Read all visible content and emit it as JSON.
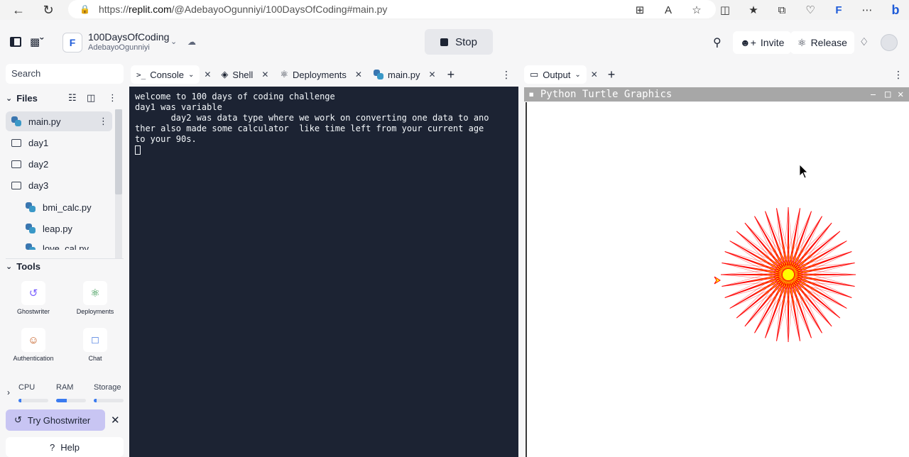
{
  "browser": {
    "url_prefix": "https://",
    "url_domain": "replit.com",
    "url_path": "/@AdebayoOgunniyi/100DaysOfCoding#main.py"
  },
  "header": {
    "repl_name": "100DaysOfCoding",
    "owner": "AdebayoOgunniyi",
    "stop_label": "Stop",
    "invite_label": "Invite",
    "release_label": "Release"
  },
  "sidebar": {
    "search_placeholder": "Search",
    "files_label": "Files",
    "files": [
      {
        "name": "main.py",
        "type": "python"
      },
      {
        "name": "day1",
        "type": "folder"
      },
      {
        "name": "day2",
        "type": "folder"
      },
      {
        "name": "day3",
        "type": "folder"
      },
      {
        "name": "bmi_calc.py",
        "type": "python"
      },
      {
        "name": "leap.py",
        "type": "python"
      },
      {
        "name": "love_cal.py",
        "type": "python"
      }
    ],
    "tools_label": "Tools",
    "tools": [
      {
        "label": "Ghostwriter",
        "icon": "ghostwriter-icon"
      },
      {
        "label": "Deployments",
        "icon": "deployments-icon"
      },
      {
        "label": "Authentication",
        "icon": "authentication-icon"
      },
      {
        "label": "Chat",
        "icon": "chat-icon"
      }
    ],
    "resources": {
      "cpu_label": "CPU",
      "ram_label": "RAM",
      "storage_label": "Storage",
      "cpu": 0.1,
      "ram": 0.35,
      "storage": 0.1
    },
    "try_ghostwriter": "Try Ghostwriter",
    "help": "Help"
  },
  "left_tabs": [
    {
      "label": "Console",
      "icon": "terminal-icon"
    },
    {
      "label": "Shell",
      "icon": "shell-icon"
    },
    {
      "label": "Deployments",
      "icon": "deployments-icon"
    },
    {
      "label": "main.py",
      "icon": "python-icon"
    }
  ],
  "console": {
    "lines": [
      "welcome to 100 days of coding challenge",
      "day1 was variable",
      "       day2 was data type where we work on converting one data to ano",
      "ther also made some calculator  like time left from your current age",
      "to your 90s."
    ]
  },
  "output": {
    "tab_label": "Output",
    "window_title": "Python Turtle Graphics",
    "star_colors": {
      "stroke": "#ff0000",
      "fill": "#ffff00"
    },
    "star_rays": 36
  },
  "colors": {
    "console_bg": "#1c2333",
    "accent": "#3a7bf0",
    "ghostwriter_bg": "#c8c5f3"
  }
}
